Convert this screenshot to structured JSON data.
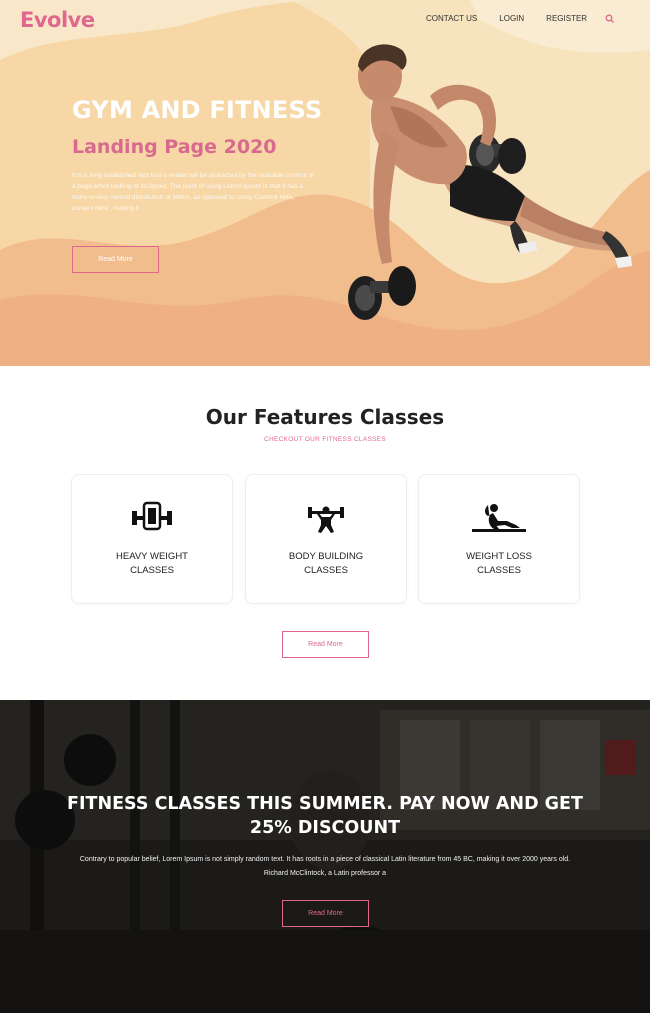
{
  "header": {
    "logo": "Evolve",
    "nav": [
      "CONTACT US",
      "LOGIN",
      "REGISTER"
    ],
    "search_icon": "search-icon"
  },
  "hero": {
    "title": "GYM AND FITNESS",
    "subtitle": "Landing Page 2020",
    "body": "It is a long established fact that a reader will be distracted by the readable content of a page when looking at its layout. The point of using Lorem Ipsum is that it has a more-or-less normal distribution of letters, as opposed to using 'Content here, content here', making it",
    "button": "Read More"
  },
  "features": {
    "title": "Our Features Classes",
    "subtitle": "CHECKOUT OUR FITNESS CLASSES",
    "cards": [
      {
        "icon": "weight-plate-icon",
        "line1": "HEAVY WEIGHT",
        "line2": "CLASSES"
      },
      {
        "icon": "barbell-lifter-icon",
        "line1": "BODY BUILDING",
        "line2": "CLASSES"
      },
      {
        "icon": "situp-icon",
        "line1": "WEIGHT LOSS",
        "line2": "CLASSES"
      }
    ],
    "button": "Read More"
  },
  "promo": {
    "title": "FITNESS CLASSES THIS SUMMER. PAY NOW AND GET 25% DISCOUNT",
    "body": "Contrary to popular belief, Lorem Ipsum is not simply random text. It has roots in a piece of classical Latin literature from 45 BC, making it over 2000 years old. Richard McClintock, a Latin professor a",
    "button": "Read More"
  },
  "colors": {
    "accent": "#e0688f",
    "hero_bg": "#f6ddb0",
    "hero_wave": "#f2b98a"
  }
}
